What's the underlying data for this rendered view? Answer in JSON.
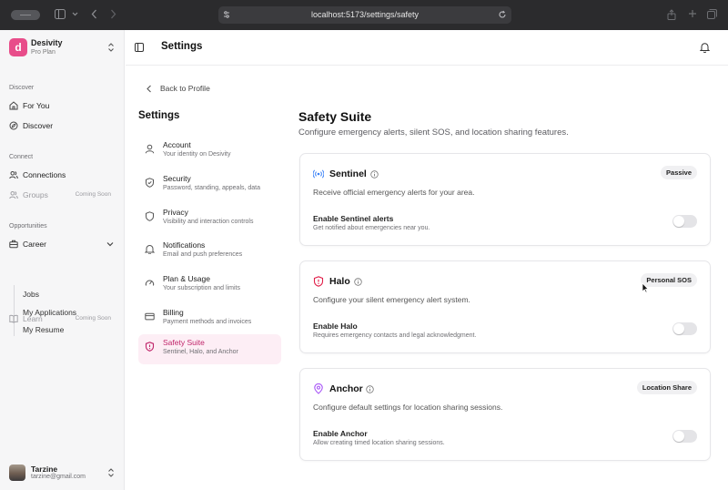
{
  "browser": {
    "url": "localhost:5173/settings/safety"
  },
  "sidebar": {
    "brand": {
      "logo_letter": "d",
      "name": "Desivity",
      "plan": "Pro Plan",
      "color": "#e84d8a"
    },
    "sections": [
      {
        "label": "Discover",
        "items": [
          {
            "label": "For You",
            "icon": "home-icon"
          },
          {
            "label": "Discover",
            "icon": "compass-icon"
          }
        ]
      },
      {
        "label": "Connect",
        "items": [
          {
            "label": "Connections",
            "icon": "users-icon"
          },
          {
            "label": "Groups",
            "icon": "users-icon",
            "badge": "Coming Soon"
          }
        ]
      },
      {
        "label": "Opportunities",
        "items": [
          {
            "label": "Career",
            "icon": "briefcase-icon",
            "sub": [
              "Jobs",
              "My Applications",
              "My Resume"
            ]
          },
          {
            "label": "Learn",
            "icon": "book-icon",
            "badge": "Coming Soon"
          }
        ]
      }
    ],
    "user": {
      "name": "Tarzine",
      "email": "tarzine@gmail.com"
    }
  },
  "header": {
    "title": "Settings"
  },
  "settings_nav": {
    "back_label": "Back to Profile",
    "heading": "Settings",
    "items": [
      {
        "title": "Account",
        "desc": "Your identity on Desivity",
        "icon": "user-icon"
      },
      {
        "title": "Security",
        "desc": "Password, standing, appeals, data",
        "icon": "shield-icon"
      },
      {
        "title": "Privacy",
        "desc": "Visibility and interaction controls",
        "icon": "shield-icon"
      },
      {
        "title": "Notifications",
        "desc": "Email and push preferences",
        "icon": "bell-icon"
      },
      {
        "title": "Plan & Usage",
        "desc": "Your subscription and limits",
        "icon": "gauge-icon"
      },
      {
        "title": "Billing",
        "desc": "Payment methods and invoices",
        "icon": "card-icon"
      },
      {
        "title": "Safety Suite",
        "desc": "Sentinel, Halo, and Anchor",
        "icon": "shield-alert-icon",
        "active": true
      }
    ]
  },
  "main": {
    "title": "Safety Suite",
    "description": "Configure emergency alerts, silent SOS, and location sharing features.",
    "cards": [
      {
        "name": "Sentinel",
        "icon": "radio-icon",
        "icon_color": "#3b82f6",
        "badge": "Passive",
        "description": "Receive official emergency alerts for your area.",
        "toggle_label": "Enable Sentinel alerts",
        "toggle_help": "Get notified about emergencies near you.",
        "enabled": false
      },
      {
        "name": "Halo",
        "icon": "shield-alert-icon",
        "icon_color": "#e11d48",
        "badge": "Personal SOS",
        "description": "Configure your silent emergency alert system.",
        "toggle_label": "Enable Halo",
        "toggle_help": "Requires emergency contacts and legal acknowledgment.",
        "enabled": false
      },
      {
        "name": "Anchor",
        "icon": "map-pin-icon",
        "icon_color": "#a855f7",
        "badge": "Location Share",
        "description": "Configure default settings for location sharing sessions.",
        "toggle_label": "Enable Anchor",
        "toggle_help": "Allow creating timed location sharing sessions.",
        "enabled": false
      }
    ]
  }
}
